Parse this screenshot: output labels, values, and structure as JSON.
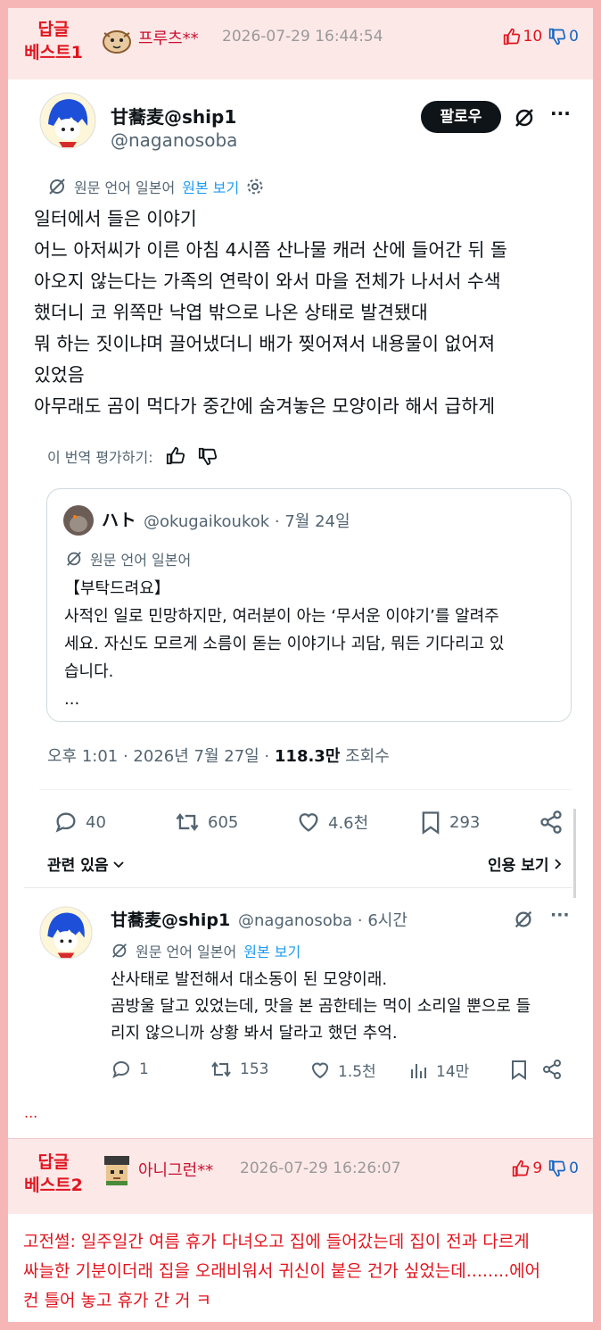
{
  "reply1": {
    "best_line1": "답글",
    "best_line2": "베스트1",
    "nickname": "프루츠**",
    "date": "2026-07-29 16:44:54",
    "up": "10",
    "down": "0"
  },
  "tweet": {
    "name": "甘蕎麦@ship1",
    "handle": "@naganosoba",
    "follow_label": "팔로우",
    "more": "···",
    "lang_note": "원문 언어 일본어",
    "view_original": "원본 보기",
    "body": [
      "일터에서 들은 이야기",
      "어느 아저씨가 이른 아침 4시쯤 산나물 캐러 산에 들어간 뒤 돌",
      "아오지 않는다는 가족의 연락이 와서 마을 전체가 나서서 수색",
      "했더니 코 위쪽만 낙엽 밖으로 나온 상태로 발견됐대",
      "뭐 하는 짓이냐며 끌어냈더니 배가 찢어져서 내용물이 없어져",
      "있었음",
      "아무래도 곰이 먹다가 중간에 숨겨놓은 모양이라 해서 급하게"
    ],
    "rate_translation": "이 번역 평가하기:",
    "quote": {
      "name": "ハト",
      "handle_date": "@okugaikoukok · 7월 24일",
      "lang_note": "원문 언어 일본어",
      "body": [
        "【부탁드려요】",
        "사적인 일로 민망하지만, 여러분이 아는 ‘무서운 이야기’를 알려주",
        "세요. 자신도 모르게 소름이 돋는 이야기나 괴담, 뭐든 기다리고 있",
        "습니다.",
        "..."
      ]
    },
    "meta_time": "오후 1:01 · 2026년 7월 27일 · ",
    "meta_views": "118.3만",
    "meta_views_label": " 조회수",
    "stats": {
      "replies": "40",
      "retweets": "605",
      "likes": "4.6천",
      "bookmarks": "293"
    },
    "related": "관련 있음",
    "view_quotes": "인용 보기"
  },
  "thread_reply": {
    "name": "甘蕎麦@ship1",
    "handle_time": "@naganosoba · 6시간",
    "lang_note": "원문 언어 일본어",
    "view_original": "원본 보기",
    "body": [
      "산사태로 발전해서 대소동이 된 모양이래.",
      "곰방울 달고 있었는데, 맛을 본 곰한테는 먹이 소리일 뿐으로 들",
      "리지 않으니까 상황 봐서 달라고 했던 추억."
    ],
    "stats": {
      "replies": "1",
      "retweets": "153",
      "likes": "1.5천",
      "views": "14만"
    }
  },
  "ellipsis": "...",
  "reply2": {
    "best_line1": "답글",
    "best_line2": "베스트2",
    "nickname": "아니그런**",
    "date": "2026-07-29 16:26:07",
    "up": "9",
    "down": "0",
    "comment": [
      "고전썰: 일주일간 여름 휴가 다녀오고 집에 들어갔는데 집이 전과 다르게",
      "싸늘한 기분이더래 집을 오래비워서 귀신이 붙은 건가 싶었는데........에어",
      "컨 틀어 놓고 휴가 간 거 ㅋ"
    ]
  },
  "colors": {
    "best_red": "#e0141e",
    "down_blue": "#1565c0",
    "header_pink": "#fde8e8",
    "frame_pink": "#f7b6b6",
    "link_blue": "#1d9bf0"
  }
}
